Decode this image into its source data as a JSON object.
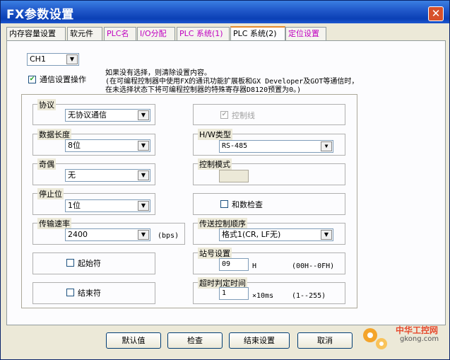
{
  "window": {
    "title": "FX参数设置",
    "close_icon": "close-icon"
  },
  "tabs": [
    {
      "label": "内存容量设置"
    },
    {
      "label": "软元件"
    },
    {
      "label": "PLC名"
    },
    {
      "label": "I/O分配"
    },
    {
      "label": "PLC 系统(1)"
    },
    {
      "label": "PLC 系统(2)"
    },
    {
      "label": "定位设置"
    }
  ],
  "channel": {
    "value": "CH1"
  },
  "comm_setting": {
    "label": "通信设置操作",
    "checked": true
  },
  "info": {
    "line1": "如果没有选择，则清除设置内容。",
    "line2": "(在可编程控制器中使用FX的通讯功能扩展板和GX Developer及GOT等通信时，",
    "line3": "在未选择状态下将可编程控制器的特殊寄存器D8120预置为0。)"
  },
  "protocol": {
    "label": "协议",
    "value": "无协议通信"
  },
  "control_line": {
    "label": "控制线",
    "checked": true
  },
  "data_length": {
    "label": "数据长度",
    "value": "8位"
  },
  "hw_type": {
    "label": "H/W类型",
    "value": "RS-485"
  },
  "parity": {
    "label": "奇偶",
    "value": "无"
  },
  "control_mode": {
    "label": "控制模式"
  },
  "stop_bit": {
    "label": "停止位",
    "value": "1位"
  },
  "sum_check": {
    "label": "和数检查",
    "checked": false
  },
  "baud": {
    "label": "传输速率",
    "value": "2400",
    "unit": "(bps)"
  },
  "transfer_order": {
    "label": "传送控制顺序",
    "value": "格式1(CR, LF无)"
  },
  "start_char": {
    "label": "起始符",
    "checked": false
  },
  "station": {
    "label": "站号设置",
    "value": "09",
    "unit": "H",
    "range": "(00H--0FH)"
  },
  "end_char": {
    "label": "结束符",
    "checked": false
  },
  "timeout": {
    "label": "超时判定时间",
    "value": "1",
    "unit": "×10ms",
    "range": "(1--255)"
  },
  "buttons": {
    "default": "默认值",
    "check": "检查",
    "end": "结束设置",
    "cancel": "取消"
  },
  "watermark": {
    "text1": "中华工控网",
    "text2": "gkong.com"
  }
}
